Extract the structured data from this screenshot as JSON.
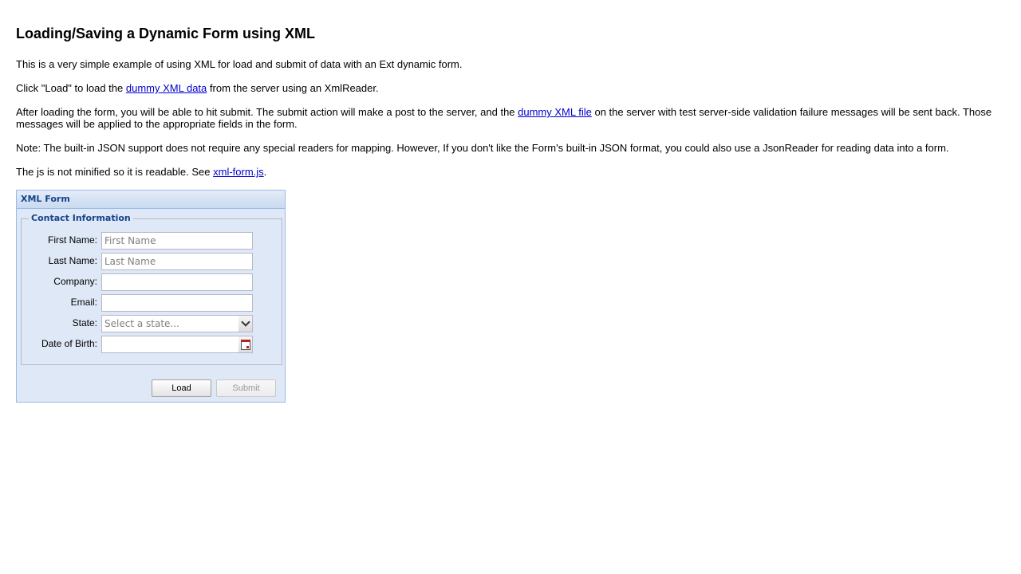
{
  "page": {
    "title": "Loading/Saving a Dynamic Form using XML",
    "intro": "This is a very simple example of using XML for load and submit of data with an Ext dynamic form.",
    "p2": {
      "before": "Click \"Load\" to load the ",
      "link": "dummy XML data",
      "after": " from the server using an XmlReader."
    },
    "p3": {
      "before": "After loading the form, you will be able to hit submit. The submit action will make a post to the server, and the ",
      "link": "dummy XML file",
      "after": " on the server with test server-side validation failure messages will be sent back. Those messages will be applied to the appropriate fields in the form."
    },
    "note": "Note: The built-in JSON support does not require any special readers for mapping. However, If you don't like the Form's built-in JSON format, you could also use a JsonReader for reading data into a form.",
    "p5": {
      "before": "The js is not minified so it is readable. See ",
      "link": "xml-form.js",
      "after": "."
    }
  },
  "form": {
    "panel_title": "XML Form",
    "fieldset_legend": "Contact Information",
    "fields": {
      "first_name": {
        "label": "First Name:",
        "placeholder": "First Name",
        "value": ""
      },
      "last_name": {
        "label": "Last Name:",
        "placeholder": "Last Name",
        "value": ""
      },
      "company": {
        "label": "Company:",
        "placeholder": "",
        "value": ""
      },
      "email": {
        "label": "Email:",
        "placeholder": "",
        "value": ""
      },
      "state": {
        "label": "State:",
        "placeholder": "Select a state...",
        "value": ""
      },
      "dob": {
        "label": "Date of Birth:",
        "placeholder": "",
        "value": ""
      }
    },
    "buttons": {
      "load": "Load",
      "submit": "Submit"
    }
  },
  "icons": {
    "state_trigger": "chevron-down-icon",
    "dob_trigger": "calendar-icon"
  },
  "colors": {
    "link": "#0000cc",
    "panel_bg": "#dfe8f6",
    "panel_border": "#99bbe8",
    "header_text": "#15428b"
  }
}
